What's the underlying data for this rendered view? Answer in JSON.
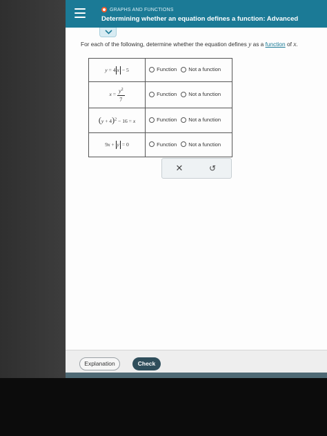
{
  "header": {
    "topic": "GRAPHS AND FUNCTIONS",
    "title": "Determining whether an equation defines a function: Advanced"
  },
  "prompt": {
    "before": "For each of the following, determine whether the equation defines ",
    "var_y": "y",
    "middle": " as a ",
    "link": "function",
    "after": " of ",
    "var_x": "x",
    "end": "."
  },
  "rows": [
    {
      "equation": "y = 4|x| − 5",
      "option_a": "Function",
      "option_b": "Not a function"
    },
    {
      "equation": "x = y²/7",
      "option_a": "Function",
      "option_b": "Not a function"
    },
    {
      "equation": "(y + 4)² − 16 = x",
      "option_a": "Function",
      "option_b": "Not a function"
    },
    {
      "equation": "9x + |y| = 0",
      "option_a": "Function",
      "option_b": "Not a function"
    }
  ],
  "actions": {
    "clear_symbol": "✕",
    "undo_symbol": "↺"
  },
  "footer": {
    "explanation_label": "Explanation",
    "check_label": "Check"
  },
  "colors": {
    "header": "#1b7a96",
    "check_button": "#2f4e5b",
    "topic_dot": "#f25a29"
  }
}
